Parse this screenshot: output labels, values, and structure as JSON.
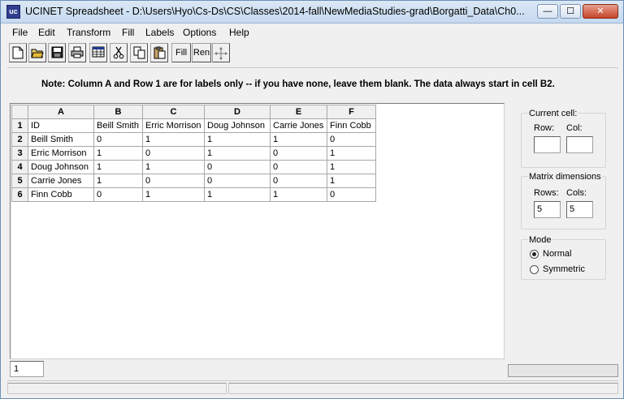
{
  "window": {
    "title": "UCINET Spreadsheet - D:\\Users\\Hyo\\Cs-Ds\\CS\\Classes\\2014-fall\\NewMediaStudies-grad\\Borgatti_Data\\Ch0...",
    "icon_text": "uc",
    "minimize_glyph": "—",
    "maximize_glyph": "☐",
    "close_glyph": "✕"
  },
  "menu": {
    "file": "File",
    "edit": "Edit",
    "transform": "Transform",
    "fill": "Fill",
    "labels": "Labels",
    "options": "Options",
    "help": "Help"
  },
  "toolbar": {
    "fill_label": "Fill",
    "ren_label": "Ren",
    "icons": [
      "new-file-icon",
      "open-folder-icon",
      "save-icon",
      "print-icon",
      "grid-icon",
      "cut-icon",
      "copy-icon",
      "paste-icon",
      "fill",
      "ren",
      "move-icon"
    ]
  },
  "note": "Note: Column A and Row 1 are for labels only  -- if you have none, leave them blank. The data always start in cell B2.",
  "grid": {
    "col_headers": [
      "A",
      "B",
      "C",
      "D",
      "E",
      "F"
    ],
    "row_headers": [
      "1",
      "2",
      "3",
      "4",
      "5",
      "6"
    ],
    "rows": [
      [
        "ID",
        "Beill Smith",
        "Erric Morrison",
        "Doug Johnson",
        "Carrie Jones",
        "Finn Cobb"
      ],
      [
        "Beill Smith",
        "0",
        "1",
        "1",
        "1",
        "0"
      ],
      [
        "Erric Morrison",
        "1",
        "0",
        "1",
        "0",
        "1"
      ],
      [
        "Doug Johnson",
        "1",
        "1",
        "0",
        "0",
        "1"
      ],
      [
        "Carrie Jones",
        "1",
        "0",
        "0",
        "0",
        "1"
      ],
      [
        "Finn Cobb",
        "0",
        "1",
        "1",
        "1",
        "0"
      ]
    ]
  },
  "current_cell": {
    "title": "Current cell:",
    "row_label": "Row:",
    "col_label": "Col:",
    "row_value": "",
    "col_value": ""
  },
  "matrix_dimensions": {
    "title": "Matrix dimensions",
    "rows_label": "Rows:",
    "cols_label": "Cols:",
    "rows_value": "5",
    "cols_value": "5"
  },
  "mode": {
    "title": "Mode",
    "normal_label": "Normal",
    "symmetric_label": "Symmetric",
    "selected": "Normal"
  },
  "bottom": {
    "cell_value": "1"
  },
  "colors": {
    "close_button": "#c5432a",
    "app_icon": "#2f3e8f"
  }
}
